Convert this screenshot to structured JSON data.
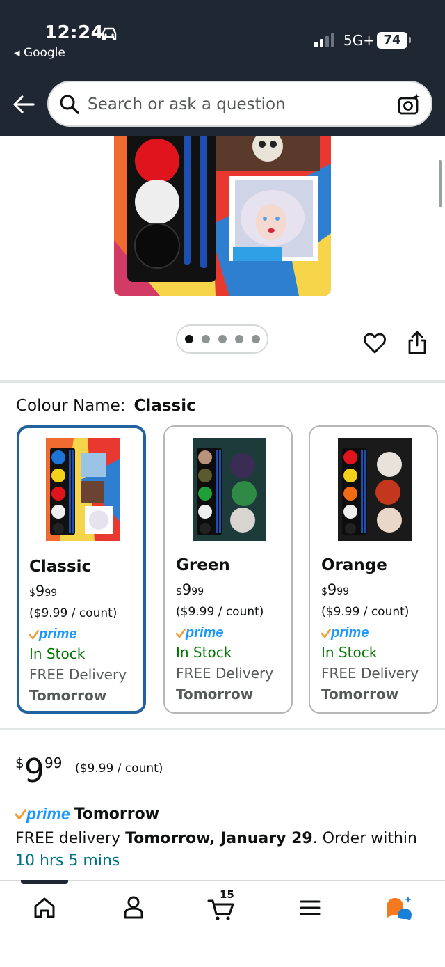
{
  "status_bar": {
    "time": "12:24",
    "back_app": "Google",
    "network": "5G+",
    "battery": "74"
  },
  "search": {
    "placeholder": "Search or ask a question"
  },
  "gallery": {
    "image_count": 5,
    "active_index": 0
  },
  "colour": {
    "label": "Colour Name:",
    "selected": "Classic",
    "options": [
      {
        "name": "Classic",
        "price_currency": "$",
        "price_whole": "9",
        "price_fraction": "99",
        "unit_price": "($9.99 / count)",
        "prime": "prime",
        "stock": "In Stock",
        "delivery": "FREE Delivery",
        "delivery_day": "Tomorrow"
      },
      {
        "name": "Green",
        "price_currency": "$",
        "price_whole": "9",
        "price_fraction": "99",
        "unit_price": "($9.99 / count)",
        "prime": "prime",
        "stock": "In Stock",
        "delivery": "FREE Delivery",
        "delivery_day": "Tomorrow"
      },
      {
        "name": "Orange",
        "price_currency": "$",
        "price_whole": "9",
        "price_fraction": "99",
        "unit_price": "($9.99 / count)",
        "prime": "prime",
        "stock": "In Stock",
        "delivery": "FREE Delivery",
        "delivery_day": "Tomorrow"
      }
    ]
  },
  "buybox": {
    "price_currency": "$",
    "price_whole": "9",
    "price_fraction": "99",
    "unit_price": "($9.99 / count)",
    "prime": "prime",
    "prime_day": "Tomorrow",
    "delivery_prefix": "FREE delivery ",
    "delivery_date": "Tomorrow, January 29",
    "delivery_suffix": ". Order within",
    "order_within": "10 hrs 5 mins"
  },
  "tabbar": {
    "cart_count": "15"
  },
  "colors": {
    "header_bg": "#1f2733",
    "selected_border": "#2162a1",
    "in_stock": "#007600",
    "prime_blue": "#1a98ff",
    "link_teal": "#007185"
  }
}
